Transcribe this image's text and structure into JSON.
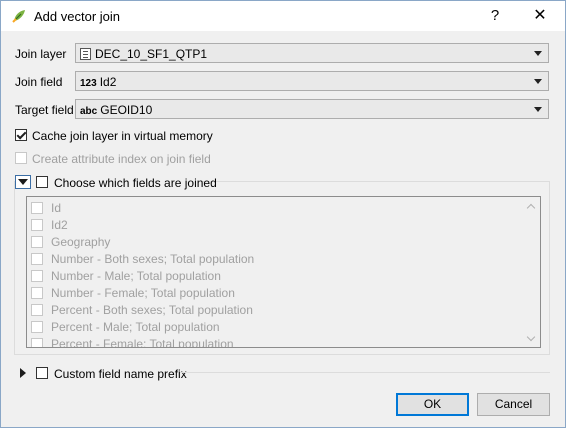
{
  "window": {
    "title": "Add vector join",
    "help_label": "?",
    "close_label": "✕"
  },
  "join_layer": {
    "label": "Join layer",
    "value": "DEC_10_SF1_QTP1",
    "icon": "table-layer-icon"
  },
  "join_field": {
    "label": "Join field",
    "type_tag": "123",
    "value": "Id2"
  },
  "target_field": {
    "label": "Target field",
    "type_tag": "abc",
    "value": "GEOID10"
  },
  "cache_option": {
    "label": "Cache join layer in virtual memory",
    "checked": true
  },
  "index_option": {
    "label": "Create attribute index on join field",
    "checked": false,
    "enabled": false
  },
  "fields_group": {
    "label": "Choose which fields are joined",
    "checked": false,
    "expanded": true,
    "fields": [
      "Id",
      "Id2",
      "Geography",
      "Number - Both sexes; Total population",
      "Number - Male; Total population",
      "Number - Female; Total population",
      "Percent - Both sexes; Total population",
      "Percent - Male; Total population",
      "Percent - Female; Total population"
    ]
  },
  "prefix_group": {
    "label": "Custom field name prefix",
    "checked": false,
    "expanded": false
  },
  "buttons": {
    "ok": "OK",
    "cancel": "Cancel"
  },
  "colors": {
    "accent": "#0078d7",
    "dialog_bg": "#f0f0f0",
    "disabled_text": "#a0a0a0"
  }
}
